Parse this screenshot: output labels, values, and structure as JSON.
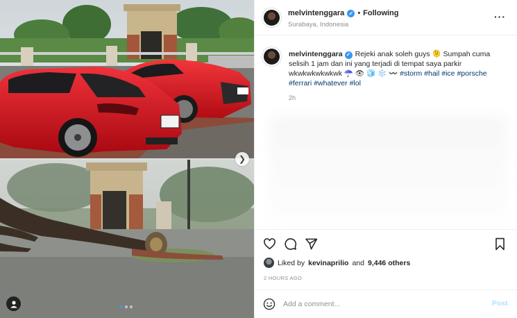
{
  "header": {
    "username": "melvintenggara",
    "separator": "•",
    "follow_status": "Following",
    "location": "Surabaya, Indonesia",
    "more_icon": "more-horizontal-icon"
  },
  "caption": {
    "username": "melvintenggara",
    "text": "Rejeki anak soleh guys 🫠 Sumpah cuma selisih 1 jam dan ini yang terjadi di tempat saya parkir wkwkwkwkwkwk ☂️ 👁 🧊 ❄️ 〰️ ",
    "hashtags": [
      "#storm",
      "#hail",
      "#ice",
      "#porsche",
      "#ferrari",
      "#whatever",
      "#lol"
    ],
    "time": "2h"
  },
  "actions": {
    "like_icon": "heart-icon",
    "comment_icon": "comment-icon",
    "share_icon": "send-icon",
    "save_icon": "bookmark-icon"
  },
  "likes": {
    "prefix": "Liked by",
    "user": "kevinaprilio",
    "middle": "and",
    "count": "9,446 others"
  },
  "posted": "2 HOURS AGO",
  "comment": {
    "placeholder": "Add a comment...",
    "post_label": "Post"
  },
  "carousel": {
    "total": 3,
    "active": 0
  },
  "colors": {
    "accent": "#3897f0",
    "link": "#00376b",
    "muted": "#8e8e8e",
    "car_red": "#d4101c"
  }
}
